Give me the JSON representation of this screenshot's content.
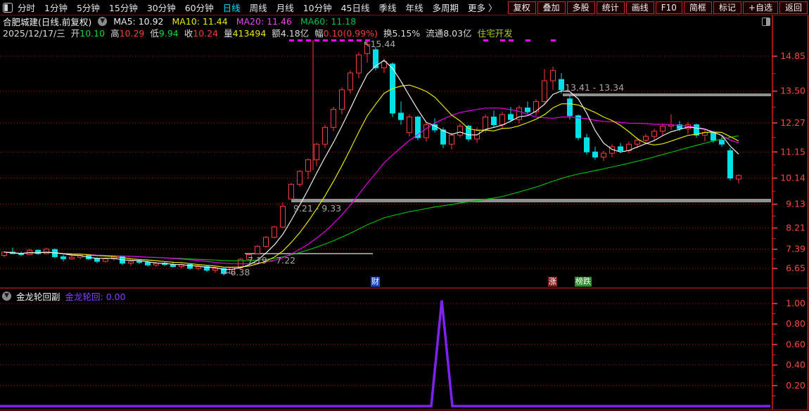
{
  "toolbar": {
    "periods": [
      "分时",
      "1分钟",
      "5分钟",
      "15分钟",
      "30分钟",
      "60分钟",
      "日线",
      "周线",
      "月线",
      "10分钟",
      "45日线",
      "季线",
      "年线",
      "多周期",
      "更多 〉"
    ],
    "active_period": "日线",
    "buttons": [
      "复权",
      "叠加",
      "多股",
      "统计",
      "画线",
      "F10",
      "简框",
      "标记",
      "+自选",
      "返回"
    ]
  },
  "info_bar": {
    "title": "合肥城建(日线.前复权)",
    "mas": [
      {
        "label": "MA5:",
        "value": "10.92",
        "color": "#ededed"
      },
      {
        "label": "MA10:",
        "value": "11.44",
        "color": "#e8e800"
      },
      {
        "label": "MA20:",
        "value": "11.46",
        "color": "#f03ef0"
      },
      {
        "label": "MA60:",
        "value": "11.18",
        "color": "#00c24a"
      }
    ]
  },
  "quote_bar": {
    "date": "2025/12/17/三",
    "fields": [
      {
        "label": "开",
        "value": "10.10",
        "color": "#00dd33"
      },
      {
        "label": "高",
        "value": "10.29",
        "color": "#ff3b3b"
      },
      {
        "label": "低",
        "value": "9.94",
        "color": "#00dd33"
      },
      {
        "label": "收",
        "value": "10.24",
        "color": "#ff3b3b"
      },
      {
        "label": "量",
        "value": "413494",
        "color": "#e8e800"
      },
      {
        "label": "额",
        "value": "4.18亿",
        "color": "#dcdcdc"
      },
      {
        "label": "幅",
        "value": "0.10(0.99%)",
        "color": "#ff3b3b"
      },
      {
        "label": "换",
        "value": "5.15%",
        "color": "#dcdcdc"
      },
      {
        "label": "流通",
        "value": "8.03亿",
        "color": "#dcdcdc"
      }
    ],
    "tag": {
      "text": "住宅开发",
      "color": "#aacc22"
    }
  },
  "chart_data": {
    "type": "candlestick",
    "title": "合肥城建 日线 前复权",
    "y_axis_labels": [
      14.85,
      13.5,
      12.27,
      11.15,
      10.14,
      9.13,
      8.21,
      7.39,
      6.65
    ],
    "scale": {
      "p_top": 14.85,
      "y_top": 80,
      "p_bottom": 6.65,
      "y_bottom": 382,
      "x0": 6,
      "pitch": 12
    },
    "colors": {
      "up": "#ff3b3b",
      "down": "#00e0ea",
      "ma5": "#f0f0f0",
      "ma10": "#e8e800",
      "ma20": "#e800e8",
      "ma60": "#00bb00",
      "grid": "#c41414",
      "axis_text": "#ff4646",
      "annotation": "#a8a8a8",
      "band": "#909090",
      "indicator": "#7e22f0",
      "signal_dash": "#ff00ff",
      "border": "#cf2020"
    },
    "ma_periods": [
      5,
      10,
      20,
      60
    ],
    "candles": [
      [
        7.15,
        7.32,
        7.08,
        7.28
      ],
      [
        7.28,
        7.45,
        7.2,
        7.22
      ],
      [
        7.22,
        7.3,
        7.12,
        7.18
      ],
      [
        7.18,
        7.4,
        7.15,
        7.35
      ],
      [
        7.35,
        7.38,
        7.18,
        7.22
      ],
      [
        7.22,
        7.45,
        7.2,
        7.4
      ],
      [
        7.38,
        7.42,
        7.05,
        7.1
      ],
      [
        7.1,
        7.18,
        6.92,
        7.02
      ],
      [
        7.02,
        7.15,
        6.98,
        7.08
      ],
      [
        7.08,
        7.22,
        7.0,
        7.15
      ],
      [
        7.15,
        7.18,
        6.98,
        7.02
      ],
      [
        7.02,
        7.08,
        6.85,
        6.92
      ],
      [
        6.92,
        7.08,
        6.88,
        7.02
      ],
      [
        7.02,
        7.15,
        6.95,
        7.1
      ],
      [
        7.1,
        7.12,
        6.78,
        6.85
      ],
      [
        6.85,
        6.98,
        6.75,
        6.92
      ],
      [
        6.92,
        7.0,
        6.82,
        6.88
      ],
      [
        6.88,
        6.95,
        6.72,
        6.78
      ],
      [
        6.78,
        6.9,
        6.7,
        6.85
      ],
      [
        6.85,
        6.92,
        6.75,
        6.8
      ],
      [
        6.8,
        6.88,
        6.68,
        6.72
      ],
      [
        6.72,
        6.85,
        6.65,
        6.8
      ],
      [
        6.8,
        6.82,
        6.6,
        6.65
      ],
      [
        6.65,
        6.78,
        6.58,
        6.72
      ],
      [
        6.72,
        6.75,
        6.52,
        6.58
      ],
      [
        6.58,
        6.7,
        6.48,
        6.65
      ],
      [
        6.65,
        6.68,
        6.38,
        6.45
      ],
      [
        6.45,
        6.72,
        6.42,
        6.68
      ],
      [
        6.68,
        7.05,
        6.62,
        7.0
      ],
      [
        7.0,
        7.19,
        6.95,
        7.18
      ],
      [
        7.22,
        7.55,
        7.22,
        7.5
      ],
      [
        7.5,
        7.9,
        7.45,
        7.85
      ],
      [
        7.85,
        8.3,
        7.8,
        8.25
      ],
      [
        8.25,
        9.21,
        8.2,
        9.05
      ],
      [
        9.33,
        9.95,
        9.33,
        9.9
      ],
      [
        9.9,
        10.45,
        9.8,
        10.4
      ],
      [
        10.4,
        10.9,
        10.1,
        10.85
      ],
      [
        10.85,
        11.5,
        10.6,
        11.45
      ],
      [
        11.45,
        12.2,
        11.3,
        12.1
      ],
      [
        12.1,
        12.9,
        11.95,
        12.8
      ],
      [
        12.8,
        13.65,
        12.6,
        13.55
      ],
      [
        13.55,
        14.3,
        13.4,
        14.2
      ],
      [
        14.2,
        15.0,
        14.0,
        14.9
      ],
      [
        14.95,
        15.44,
        14.6,
        15.3
      ],
      [
        15.1,
        15.2,
        14.3,
        14.4
      ],
      [
        14.4,
        14.75,
        14.2,
        14.65
      ],
      [
        14.55,
        14.6,
        12.5,
        12.65
      ],
      [
        12.65,
        13.1,
        12.2,
        12.4
      ],
      [
        11.9,
        12.6,
        11.75,
        12.5
      ],
      [
        12.5,
        12.55,
        11.6,
        11.7
      ],
      [
        11.7,
        12.3,
        11.55,
        12.2
      ],
      [
        12.2,
        12.45,
        11.9,
        12.0
      ],
      [
        12.0,
        12.1,
        11.3,
        11.45
      ],
      [
        11.45,
        11.9,
        11.25,
        11.8
      ],
      [
        11.8,
        12.25,
        11.7,
        12.15
      ],
      [
        12.15,
        12.2,
        11.55,
        11.65
      ],
      [
        11.65,
        12.1,
        11.5,
        12.0
      ],
      [
        12.0,
        12.6,
        11.9,
        12.5
      ],
      [
        12.5,
        12.75,
        12.1,
        12.2
      ],
      [
        12.2,
        12.7,
        12.05,
        12.6
      ],
      [
        12.6,
        12.9,
        12.3,
        12.4
      ],
      [
        12.4,
        12.95,
        12.25,
        12.85
      ],
      [
        12.85,
        13.1,
        12.6,
        12.7
      ],
      [
        12.7,
        13.2,
        12.55,
        13.1
      ],
      [
        13.1,
        14.35,
        13.0,
        13.9
      ],
      [
        13.9,
        14.45,
        13.55,
        14.3
      ],
      [
        13.95,
        14.2,
        13.41,
        13.55
      ],
      [
        13.2,
        13.34,
        12.4,
        12.55
      ],
      [
        12.55,
        12.6,
        11.6,
        11.7
      ],
      [
        11.7,
        11.85,
        11.05,
        11.15
      ],
      [
        11.15,
        11.35,
        10.85,
        10.95
      ],
      [
        10.95,
        11.2,
        10.8,
        11.1
      ],
      [
        11.1,
        11.45,
        10.95,
        11.35
      ],
      [
        11.35,
        11.5,
        11.1,
        11.2
      ],
      [
        11.2,
        11.55,
        11.1,
        11.45
      ],
      [
        11.45,
        11.7,
        11.3,
        11.6
      ],
      [
        11.6,
        11.85,
        11.45,
        11.75
      ],
      [
        11.75,
        12.05,
        11.6,
        11.95
      ],
      [
        11.95,
        12.25,
        11.8,
        12.15
      ],
      [
        12.15,
        12.6,
        12.0,
        12.2
      ],
      [
        12.2,
        12.35,
        11.95,
        12.05
      ],
      [
        12.05,
        12.3,
        11.85,
        12.2
      ],
      [
        12.2,
        12.25,
        11.7,
        11.8
      ],
      [
        11.8,
        12.0,
        11.55,
        11.9
      ],
      [
        11.9,
        11.95,
        11.5,
        11.6
      ],
      [
        11.6,
        11.75,
        11.35,
        11.45
      ],
      [
        11.2,
        11.3,
        10.05,
        10.14
      ],
      [
        10.1,
        10.29,
        9.94,
        10.24
      ]
    ],
    "annotations": [
      {
        "text": "↖15.44",
        "x": 516,
        "y": 67
      },
      {
        "text": "13.41 - 13.34",
        "x": 803,
        "y": 129
      },
      {
        "text": "9.21 - 9.33",
        "x": 417,
        "y": 301
      },
      {
        "text": "7.19 - 7.22",
        "x": 352,
        "y": 375
      },
      {
        "text": "←6.38",
        "x": 317,
        "y": 392
      }
    ],
    "gap_bands": [
      {
        "x1": 800,
        "x2": 1096,
        "y": 133,
        "h": 4
      },
      {
        "x1": 414,
        "x2": 1096,
        "y": 283,
        "h": 5
      },
      {
        "x1": 348,
        "x2": 530,
        "y": 360,
        "h": 2
      }
    ],
    "signal_dash_days": [
      34,
      35,
      36,
      37,
      38,
      39,
      40,
      41,
      42,
      43,
      57,
      59,
      60,
      62,
      65
    ],
    "marker_line": {
      "x": 445,
      "y1": 57,
      "y2": 242
    },
    "events": [
      {
        "label": "财",
        "x": 527,
        "bg": "#1d45cf"
      },
      {
        "label": "涨",
        "x": 779,
        "bg": "#8a2020"
      },
      {
        "label": "榜跌",
        "x": 817,
        "bg": "#2c8a2c"
      }
    ],
    "sub": {
      "name": "金龙轮回副",
      "label": "金龙轮回:",
      "value": "0.00",
      "color": "#8640ff",
      "axis_labels": [
        1.0,
        0.8,
        0.6,
        0.4,
        0.2
      ],
      "scale": {
        "y_base": 578,
        "y_per_unit": 146
      },
      "series": [
        [
          0,
          0
        ],
        [
          613,
          0
        ],
        [
          628,
          1.03
        ],
        [
          643,
          0
        ],
        [
          1095,
          0
        ]
      ]
    }
  }
}
